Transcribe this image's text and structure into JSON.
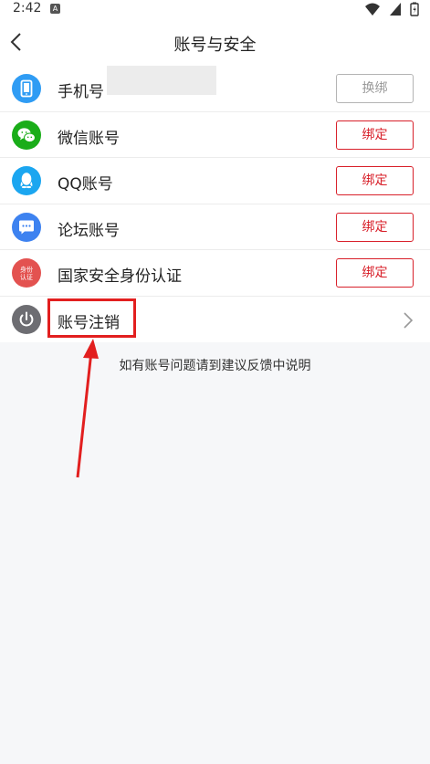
{
  "status_bar": {
    "time": "2:42",
    "notification_letter": "A"
  },
  "header": {
    "title": "账号与安全"
  },
  "rows": [
    {
      "label": "手机号",
      "button": "换绑",
      "icon": "phone-icon",
      "icon_color": "#2f9cf4"
    },
    {
      "label": "微信账号",
      "button": "绑定",
      "icon": "wechat-icon",
      "icon_color": "#1aad19"
    },
    {
      "label": "QQ账号",
      "button": "绑定",
      "icon": "qq-icon",
      "icon_color": "#1ba6f0"
    },
    {
      "label": "论坛账号",
      "button": "绑定",
      "icon": "forum-chat-icon",
      "icon_color": "#3d82f0"
    },
    {
      "label": "国家安全身份认证",
      "button": "绑定",
      "icon": "identity-auth-icon",
      "icon_color": "#e35250",
      "icon_text_1": "身份",
      "icon_text_2": "认证"
    },
    {
      "label": "账号注销",
      "icon": "power-icon",
      "icon_color": "#6d6d72"
    }
  ],
  "hint": "如有账号问题请到建议反馈中说明",
  "colors": {
    "accent_red": "#d8202a",
    "annotation_red": "#e21f1f"
  }
}
